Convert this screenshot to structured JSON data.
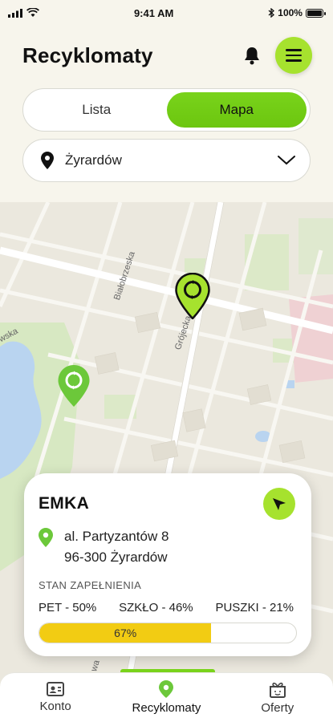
{
  "status_bar": {
    "time": "9:41 AM",
    "battery": "100%"
  },
  "header": {
    "title": "Recyklomaty"
  },
  "view_toggle": {
    "options": [
      "Lista",
      "Mapa"
    ],
    "selected": "Mapa"
  },
  "city_select": {
    "value": "Żyrardów"
  },
  "map": {
    "street_labels": [
      "Białobrzeska",
      "Grójecka",
      "wska",
      "wa"
    ],
    "markers": [
      {
        "name": "recycling-machine-marker-1",
        "selected": true
      },
      {
        "name": "recycling-machine-marker-2",
        "selected": false
      }
    ]
  },
  "card": {
    "name": "EMKA",
    "address_line1": "al. Partyzantów 8",
    "address_line2": "96-300 Żyrardów",
    "fill_label": "STAN ZAPEŁNIENIA",
    "fill_items": [
      "PET - 50%",
      "SZKŁO - 46%",
      "PUSZKI - 21%"
    ],
    "progress_label": "67%",
    "progress_value": 0.67
  },
  "tabs": [
    {
      "label": "Konto",
      "icon": "account-card-icon"
    },
    {
      "label": "Recyklomaty",
      "icon": "location-pin-icon"
    },
    {
      "label": "Oferty",
      "icon": "gift-icon"
    }
  ],
  "colors": {
    "accent": "#a6e22e",
    "active_segment": "#79d31b",
    "progress": "#f2cc13",
    "marker": "#8ed81e"
  }
}
